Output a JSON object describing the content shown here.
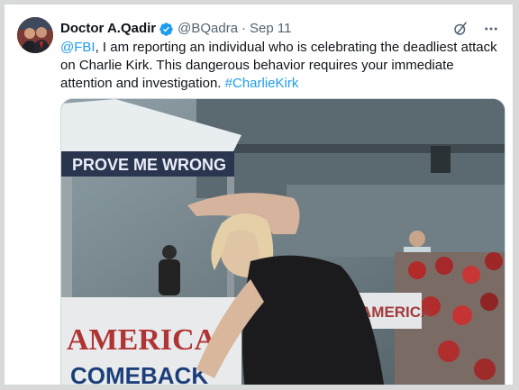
{
  "tweet": {
    "author_name": "Doctor A.Qadir",
    "handle": "@BQadra",
    "separator": "·",
    "date": "Sep 11",
    "text_mention": "@FBI",
    "text_body": ", I am reporting an individual who is celebrating the deadliest attack on Charlie Kirk. This dangerous behavior requires your immediate attention and investigation. ",
    "hashtag": "#CharlieKirk"
  },
  "media": {
    "banner_text": "PROVE ME WRONG",
    "sign_text_1": "AMERICA",
    "sign_text_2": "COMEBACK",
    "sign_text_3": "AMERICA"
  },
  "icons": {
    "verified": "verified-badge-icon",
    "grok": "grok-icon",
    "more": "more-icon"
  },
  "colors": {
    "link": "#1d9bf0",
    "verified": "#1d9bf0",
    "text": "#0f1419",
    "muted": "#536471"
  }
}
